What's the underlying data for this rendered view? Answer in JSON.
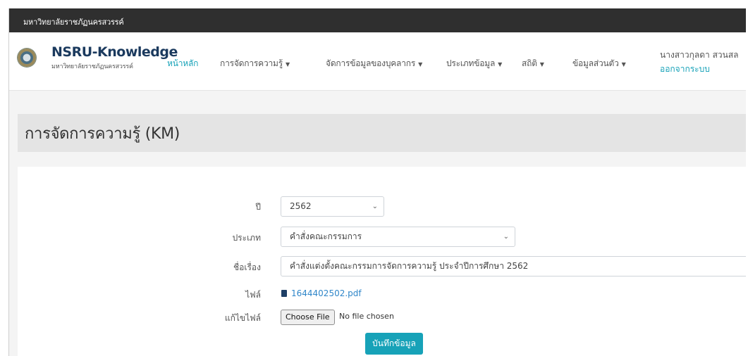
{
  "top_strip": {
    "university": "มหาวิทยาลัยราชภัฏนครสวรรค์"
  },
  "brand": {
    "name": "NSRU-Knowledge",
    "subtitle": "มหาวิทยาลัยราชภัฏนครสวรรค์"
  },
  "nav": [
    {
      "label": "หน้าหลัก",
      "active": true,
      "dropdown": false
    },
    {
      "label": "การจัดการความรู้",
      "active": false,
      "dropdown": true
    },
    {
      "label": "จัดการข้อมูลของบุคลากร",
      "active": false,
      "dropdown": true
    },
    {
      "label": "ประเภทข้อมูล",
      "active": false,
      "dropdown": true
    },
    {
      "label": "สถิติ",
      "active": false,
      "dropdown": true
    },
    {
      "label": "ข้อมูลส่วนตัว",
      "active": false,
      "dropdown": true
    }
  ],
  "user": {
    "name": "นางสาวกุลดา สวนสล",
    "logout": "ออกจากระบบ"
  },
  "page": {
    "title": "การจัดการความรู้ (KM)"
  },
  "form": {
    "year_label": "ปี",
    "year_value": "2562",
    "type_label": "ประเภท",
    "type_value": "คำสั่งคณะกรรมการ",
    "subject_label": "ชื่อเรื่อง",
    "subject_value": "คำสั่งแต่งตั้งคณะกรรมการจัดการความรู้ ประจำปีการศึกษา 2562",
    "file_label": "ไฟล์",
    "file_name": "1644402502.pdf",
    "edit_file_label": "แก้ไขไฟล์",
    "choose_file": "Choose File",
    "no_file": "No file chosen",
    "save": "บันทึกข้อมูล"
  },
  "colors": {
    "accent": "#17a2b8",
    "topbar": "#2f2f2f",
    "brand": "#1b3a5e",
    "link": "#2f86c9"
  },
  "icons": {
    "caret": "chevron-down-icon",
    "file": "document-icon"
  }
}
